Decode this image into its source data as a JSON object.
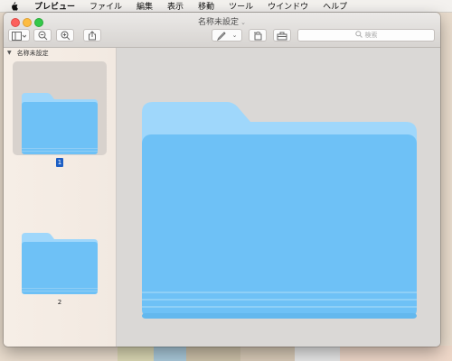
{
  "menubar": {
    "app_name": "プレビュー",
    "items": [
      "ファイル",
      "編集",
      "表示",
      "移動",
      "ツール",
      "ウインドウ",
      "ヘルプ"
    ]
  },
  "window": {
    "title": "名称未設定",
    "search_placeholder": "検索"
  },
  "sidebar": {
    "section_title": "名称未設定",
    "pages": [
      "1",
      "2"
    ],
    "selected_page": "1"
  },
  "icons": {
    "thumbnail": "folder-icon",
    "main": "folder-icon"
  },
  "colors": {
    "folder_light": "#9fd7fb",
    "folder_body": "#6ec1f6",
    "selection": "#1d5fc4"
  }
}
